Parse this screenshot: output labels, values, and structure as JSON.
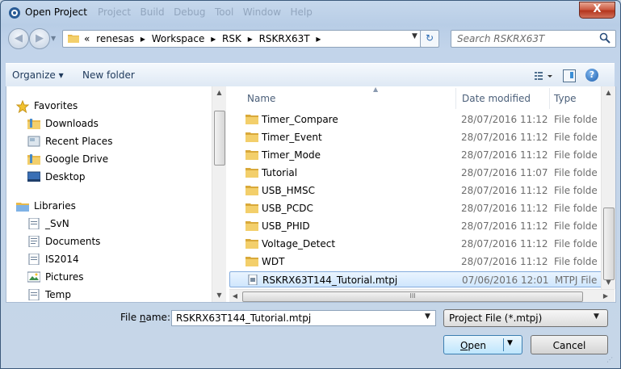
{
  "window": {
    "title": "Open Project",
    "ghost_menu": "Project   Build   Debug   Tool   Window   Help",
    "close_label": "X"
  },
  "address": {
    "overflow": "«",
    "separator": "▸",
    "crumbs": [
      "renesas",
      "Workspace",
      "RSK",
      "RSKRX63T"
    ]
  },
  "search": {
    "placeholder": "Search RSKRX63T"
  },
  "toolbar": {
    "organize_label": "Organize ▾",
    "new_folder_label": "New folder",
    "help_label": "?"
  },
  "nav": {
    "items": [
      {
        "label": "Favorites",
        "icon": "star-icon"
      },
      {
        "label": "Downloads",
        "icon": "folder-icon"
      },
      {
        "label": "Recent Places",
        "icon": "recent-places-icon"
      },
      {
        "label": "Google Drive",
        "icon": "folder-icon"
      },
      {
        "label": "Desktop",
        "icon": "desktop-icon"
      },
      {
        "label": "Libraries",
        "icon": "libraries-icon"
      },
      {
        "label": "_SvN",
        "icon": "library-icon"
      },
      {
        "label": "Documents",
        "icon": "documents-icon"
      },
      {
        "label": "IS2014",
        "icon": "library-icon"
      },
      {
        "label": "Pictures",
        "icon": "pictures-icon"
      },
      {
        "label": "Temp",
        "icon": "library-icon"
      }
    ]
  },
  "columns": {
    "name": "Name",
    "date": "Date modified",
    "type": "Type"
  },
  "files": [
    {
      "name": "Timer_Compare",
      "date": "28/07/2016 11:12",
      "type": "File folde",
      "kind": "folder"
    },
    {
      "name": "Timer_Event",
      "date": "28/07/2016 11:12",
      "type": "File folde",
      "kind": "folder"
    },
    {
      "name": "Timer_Mode",
      "date": "28/07/2016 11:12",
      "type": "File folde",
      "kind": "folder"
    },
    {
      "name": "Tutorial",
      "date": "28/07/2016 11:07",
      "type": "File folde",
      "kind": "folder"
    },
    {
      "name": "USB_HMSC",
      "date": "28/07/2016 11:12",
      "type": "File folde",
      "kind": "folder"
    },
    {
      "name": "USB_PCDC",
      "date": "28/07/2016 11:12",
      "type": "File folde",
      "kind": "folder"
    },
    {
      "name": "USB_PHID",
      "date": "28/07/2016 11:12",
      "type": "File folde",
      "kind": "folder"
    },
    {
      "name": "Voltage_Detect",
      "date": "28/07/2016 11:12",
      "type": "File folde",
      "kind": "folder"
    },
    {
      "name": "WDT",
      "date": "28/07/2016 11:12",
      "type": "File folde",
      "kind": "folder"
    },
    {
      "name": "RSKRX63T144_Tutorial.mtpj",
      "date": "07/06/2016 12:01",
      "type": "MTPJ File",
      "kind": "file",
      "selected": true
    }
  ],
  "hscroll_thumb": "III",
  "filename": {
    "label_prefix": "File ",
    "label_accel": "n",
    "label_suffix": "ame:",
    "value": "RSKRX63T144_Tutorial.mtpj"
  },
  "filetype": {
    "value": "Project File (*.mtpj)"
  },
  "buttons": {
    "open_accel": "O",
    "open_rest": "pen",
    "cancel": "Cancel"
  },
  "colors": {
    "folder": "#e8b94a",
    "selection": "#cfe6fd",
    "accent": "#3c7fb1"
  }
}
